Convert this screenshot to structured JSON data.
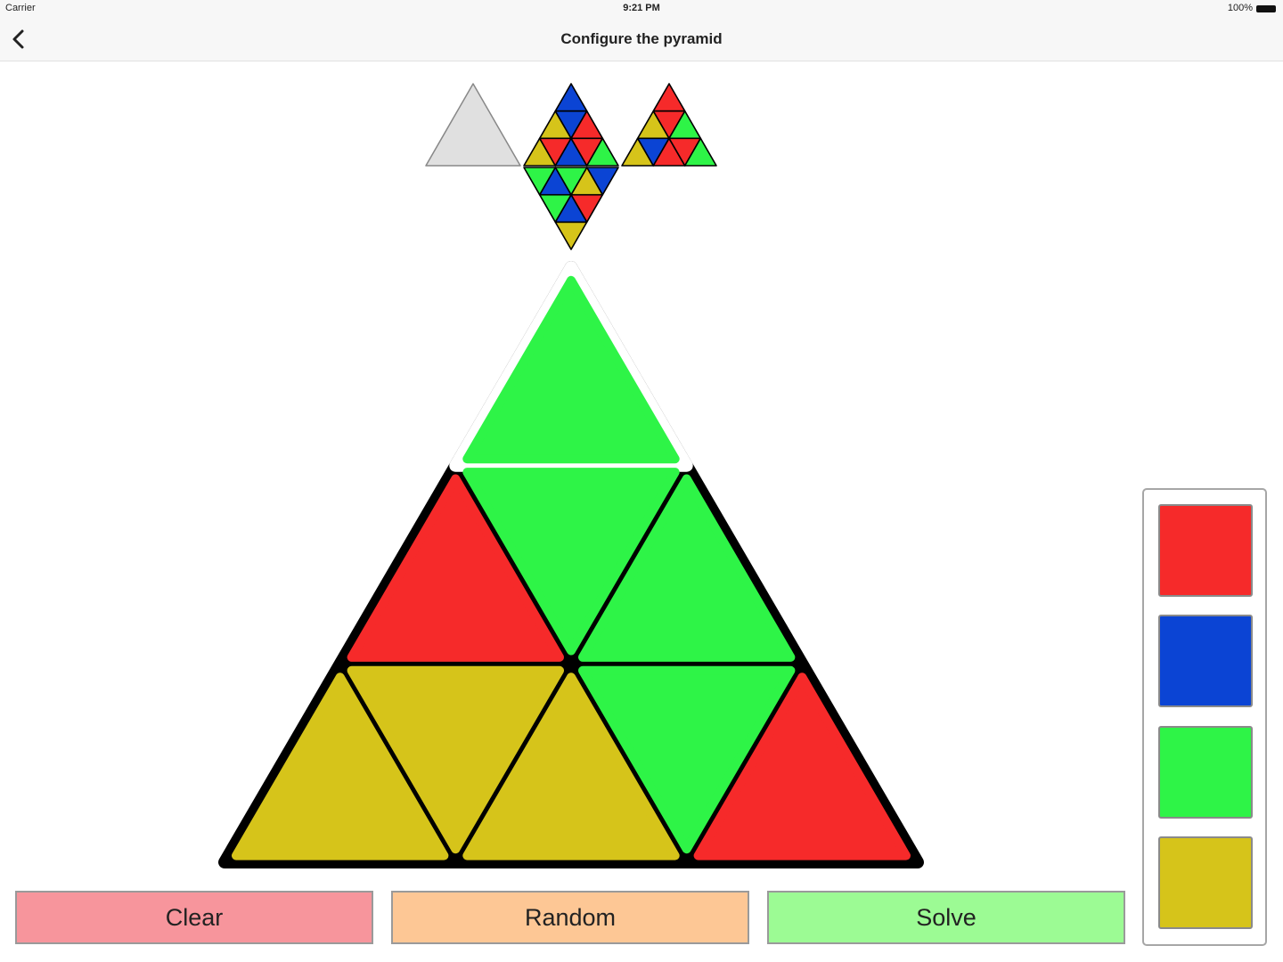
{
  "status_bar": {
    "carrier": "Carrier",
    "time": "9:21 PM",
    "battery": "100%"
  },
  "nav": {
    "title": "Configure the pyramid",
    "back_icon": "chevron-left-icon"
  },
  "colors": {
    "red": "#f62a2a",
    "blue": "#0b44d4",
    "green": "#2ef447",
    "yellow": "#d6c41a",
    "empty": "#e0e0e0",
    "outline": "#000000"
  },
  "net": {
    "left_face": "empty",
    "front_face": [
      "blue",
      "yellow",
      "blue",
      "red",
      "yellow",
      "red",
      "blue",
      "red",
      "green"
    ],
    "right_face": [
      "red",
      "yellow",
      "red",
      "green",
      "yellow",
      "blue",
      "red",
      "red",
      "green"
    ],
    "bottom_face": [
      "yellow",
      "red",
      "blue",
      "green",
      "blue",
      "yellow",
      "green",
      "blue",
      "green"
    ]
  },
  "main_face": {
    "selected_piece": "top",
    "pieces": [
      "green",
      "red",
      "green",
      "green",
      "yellow",
      "yellow",
      "yellow",
      "green",
      "red"
    ]
  },
  "buttons": {
    "clear": {
      "label": "Clear",
      "color": "#f7959c"
    },
    "random": {
      "label": "Random",
      "color": "#fdc795"
    },
    "solve": {
      "label": "Solve",
      "color": "#9cfb94"
    }
  },
  "palette": [
    {
      "name": "red",
      "color": "#f62a2a"
    },
    {
      "name": "blue",
      "color": "#0b44d4"
    },
    {
      "name": "green",
      "color": "#2ef447"
    },
    {
      "name": "yellow",
      "color": "#d6c41a"
    }
  ]
}
